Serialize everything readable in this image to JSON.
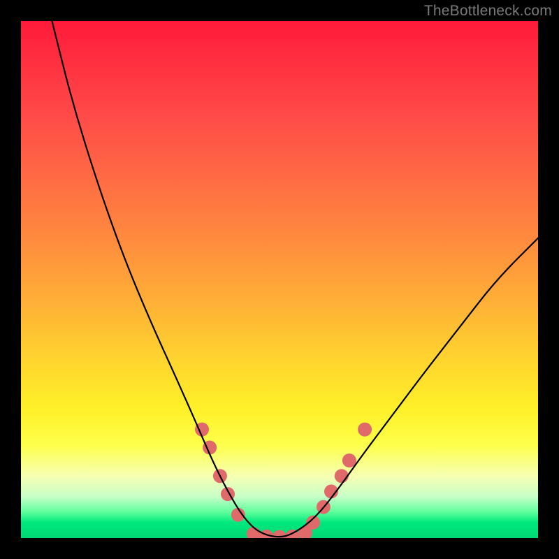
{
  "watermark": "TheBottleneck.com",
  "chart_data": {
    "type": "line",
    "title": "",
    "xlabel": "",
    "ylabel": "",
    "xlim": [
      0,
      100
    ],
    "ylim": [
      0,
      100
    ],
    "grid": false,
    "legend": false,
    "series": [
      {
        "name": "bottleneck-curve",
        "color": "#000000",
        "x": [
          6,
          10,
          15,
          20,
          25,
          30,
          34,
          37,
          40,
          43,
          46,
          50,
          53,
          57,
          61,
          66,
          72,
          78,
          85,
          92,
          100
        ],
        "y": [
          100,
          84,
          68,
          54,
          42,
          31,
          22,
          15,
          9,
          4,
          1,
          0,
          1,
          4,
          9,
          16,
          24,
          32,
          41,
          50,
          58
        ]
      }
    ],
    "markers": {
      "name": "highlight-dots",
      "color": "#e06a6a",
      "radius_px": 10,
      "points": [
        {
          "x": 35.0,
          "y": 21.0
        },
        {
          "x": 36.5,
          "y": 17.5
        },
        {
          "x": 38.5,
          "y": 12.0
        },
        {
          "x": 40.0,
          "y": 8.5
        },
        {
          "x": 42.0,
          "y": 4.5
        },
        {
          "x": 45.0,
          "y": 0.8
        },
        {
          "x": 47.5,
          "y": 0.3
        },
        {
          "x": 50.0,
          "y": 0.2
        },
        {
          "x": 52.5,
          "y": 0.3
        },
        {
          "x": 55.0,
          "y": 1.0
        },
        {
          "x": 56.5,
          "y": 3.0
        },
        {
          "x": 58.5,
          "y": 6.0
        },
        {
          "x": 60.0,
          "y": 9.0
        },
        {
          "x": 62.0,
          "y": 12.0
        },
        {
          "x": 63.5,
          "y": 15.0
        },
        {
          "x": 66.5,
          "y": 21.0
        }
      ]
    },
    "background_gradient": {
      "top": "#ff1a3a",
      "mid": "#ffe628",
      "bottom": "#00d874"
    }
  }
}
